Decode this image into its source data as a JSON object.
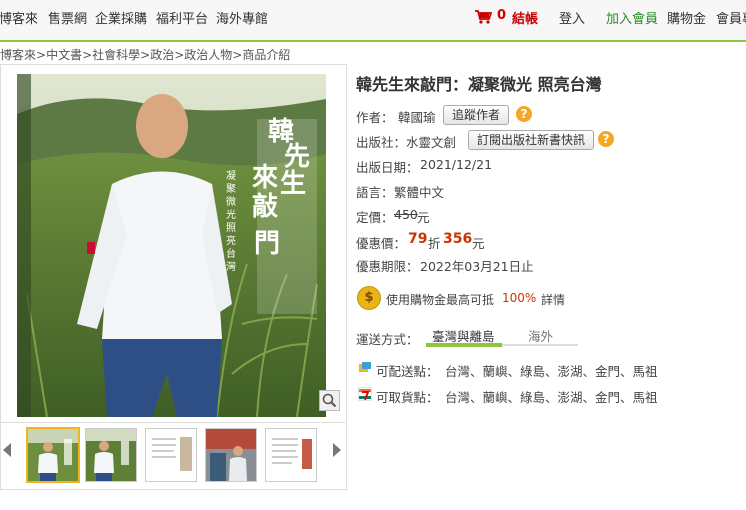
{
  "header": {
    "links": [
      "博客來",
      "售票網",
      "企業採購",
      "福利平台",
      "海外專館"
    ],
    "cart_count": "0",
    "checkout": "結帳",
    "login": "登入",
    "join": "加入會員",
    "wallet": "購物金",
    "member": "會員專"
  },
  "breadcrumb": [
    "博客來",
    ">中文書",
    ">社會科學",
    ">政治",
    ">政治人物",
    ">商品介紹"
  ],
  "cover": {
    "title_chars": [
      "韓",
      "先",
      "生",
      "來",
      "敲",
      "門"
    ],
    "subtitle": "凝聚微光 照亮台灣"
  },
  "book": {
    "title": "韓先生來敲門：凝聚微光 照亮台灣",
    "author_label": "作者：",
    "author": "韓國瑜",
    "follow_author": "追蹤作者",
    "publisher_label": "出版社：",
    "publisher": "水靈文創",
    "subscribe_publisher": "訂閱出版社新書快訊",
    "pubdate_label": "出版日期：",
    "pubdate": "2021/12/21",
    "lang_label": "語言：",
    "lang": "繁體中文",
    "list_price_label": "定價：",
    "list_price": "450",
    "currency": "元",
    "sale_label": "優惠價：",
    "discount": "79",
    "discount_unit": "折",
    "sale_price": "356",
    "sale_currency": "元",
    "period_label": "優惠期限：",
    "period": "2022年03月21日止"
  },
  "wallet_promo": {
    "text_before": "使用購物金最高可抵",
    "percent": "100%",
    "detail": "詳情"
  },
  "shipping": {
    "label": "運送方式：",
    "tab_active": "臺灣與離島",
    "tab_other": "海外"
  },
  "delivery": {
    "deliverable_label": "可配送點：",
    "deliverable": "台灣、蘭嶼、綠島、澎湖、金門、馬祖",
    "pickup_label": "可取貨點：",
    "pickup": "台灣、蘭嶼、綠島、澎湖、金門、馬祖"
  },
  "colors": {
    "accent_green": "#8cc63f",
    "price_red": "#cc3300",
    "help_orange": "#f5a623"
  }
}
